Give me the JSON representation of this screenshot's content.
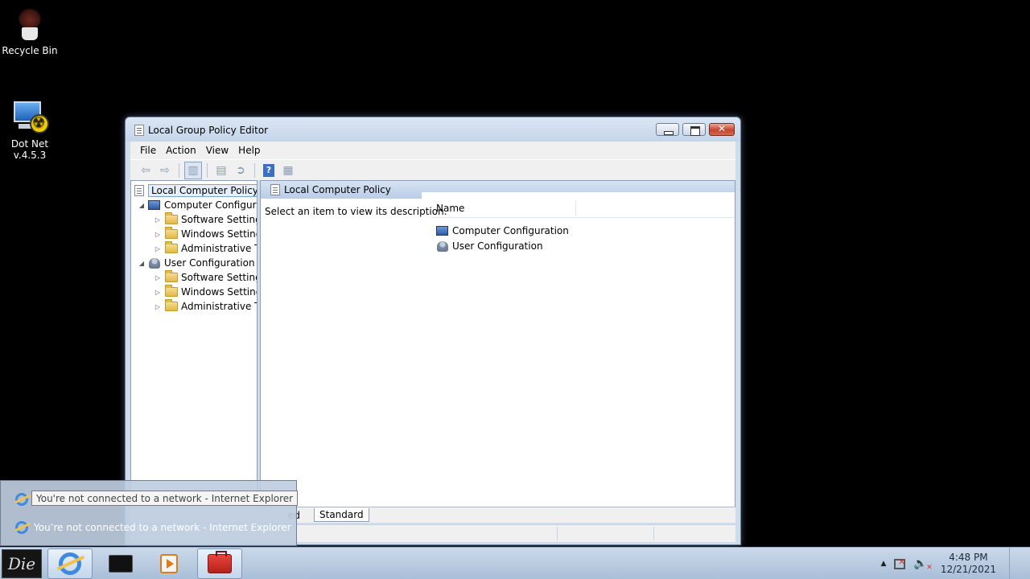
{
  "desktop": {
    "icons": [
      {
        "label": "Recycle Bin",
        "icon": "recycle-bin-icon"
      },
      {
        "label_line1": "Dot Net",
        "label_line2": "v.4.5.3",
        "icon": "dotnet-installer-icon"
      }
    ]
  },
  "window": {
    "title": "Local Group Policy Editor",
    "menu": [
      "File",
      "Action",
      "View",
      "Help"
    ],
    "toolbar": [
      "back-arrow-icon",
      "forward-arrow-icon",
      "show-hide-console-tree-icon",
      "properties-icon",
      "export-list-icon",
      "help-icon",
      "view-icon"
    ],
    "tree": {
      "root": "Local Computer Policy",
      "computer_config": "Computer Configura",
      "computer_children": [
        "Software Settings",
        "Windows Setting",
        "Administrative Te"
      ],
      "user_config": "User Configuration",
      "user_children": [
        "Software Settings",
        "Windows Setting",
        "Administrative Te"
      ]
    },
    "right_pane": {
      "header": "Local Computer Policy",
      "description": "Select an item to view its description.",
      "column_name": "Name",
      "items": [
        "Computer Configuration",
        "User Configuration"
      ]
    },
    "tabs": {
      "extended": "ed",
      "standard": "Standard"
    }
  },
  "popup": {
    "tooltip": "You're not connected to a network - Internet Explorer",
    "item": "You’re not connected to a network - Internet Explorer"
  },
  "taskbar": {
    "start_label": "Die",
    "clock_time": "4:48 PM",
    "clock_date": "12/21/2021"
  },
  "colors": {
    "desktop_bg": "#000000",
    "taskbar": "#b8cce3",
    "accent": "#3d8ae0"
  }
}
